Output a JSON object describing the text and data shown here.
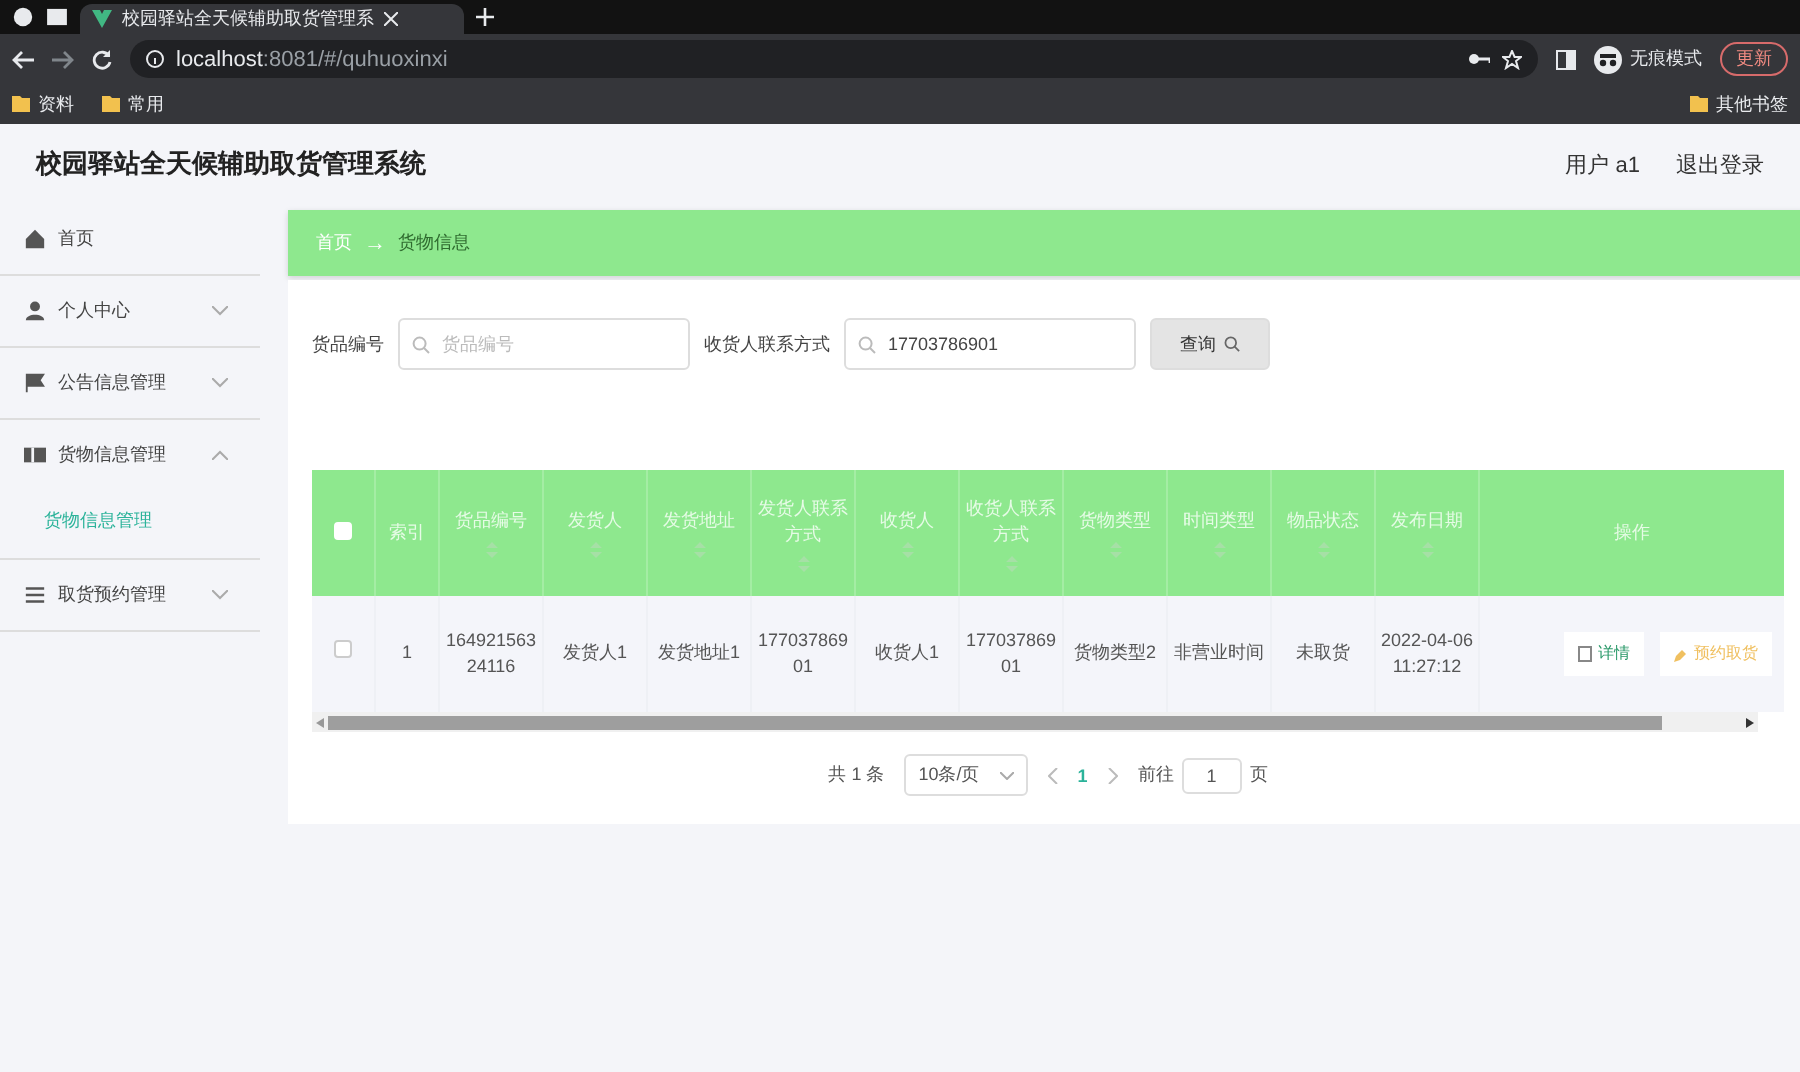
{
  "browser": {
    "tab_title": "校园驿站全天候辅助取货管理系",
    "address_host": "localhost",
    "address_rest": ":8081/#/quhuoxinxi",
    "profile_label": "无痕模式",
    "update_button": "更新",
    "bookmarks": [
      "资料",
      "常用"
    ],
    "other_bookmarks": "其他书签"
  },
  "header": {
    "title": "校园驿站全天候辅助取货管理系统",
    "user": "用户 a1",
    "logout": "退出登录"
  },
  "sidebar": {
    "items": [
      {
        "label": "首页",
        "kind": "link"
      },
      {
        "label": "个人中心",
        "kind": "menu",
        "expanded": false
      },
      {
        "label": "公告信息管理",
        "kind": "menu",
        "expanded": false
      },
      {
        "label": "货物信息管理",
        "kind": "menu",
        "expanded": true,
        "children": [
          {
            "label": "货物信息管理",
            "selected": true
          }
        ]
      },
      {
        "label": "取货预约管理",
        "kind": "menu",
        "expanded": false
      }
    ]
  },
  "breadcrumb": {
    "items": [
      "首页",
      "货物信息"
    ],
    "separator": "→"
  },
  "search": {
    "fields": [
      {
        "label": "货品编号",
        "placeholder": "货品编号"
      },
      {
        "label": "收货人联系方式",
        "value": "17703786901"
      }
    ],
    "button": "查询"
  },
  "table": {
    "select_all_checked": false,
    "columns": [
      {
        "label": "索引",
        "sortable": false
      },
      {
        "label": "货品编号",
        "sortable": true
      },
      {
        "label": "发货人",
        "sortable": true
      },
      {
        "label": "发货地址",
        "sortable": true
      },
      {
        "label": "发货人联系方式",
        "sortable": true
      },
      {
        "label": "收货人",
        "sortable": true
      },
      {
        "label": "收货人联系方式",
        "sortable": true
      },
      {
        "label": "货物类型",
        "sortable": true
      },
      {
        "label": "时间类型",
        "sortable": true
      },
      {
        "label": "物品状态",
        "sortable": true
      },
      {
        "label": "发布日期",
        "sortable": true
      },
      {
        "label": "操作",
        "sortable": false
      }
    ],
    "rows": [
      {
        "checked": false,
        "cells": [
          "1",
          "16492156324116",
          "发货人1",
          "发货地址1",
          "17703786901",
          "收货人1",
          "17703786901",
          "货物类型2",
          "非营业时间",
          "未取货",
          "2022-04-06 11:27:12"
        ],
        "actions": [
          {
            "label": "详情",
            "kind": "view"
          },
          {
            "label": "预约取货",
            "kind": "book"
          }
        ]
      }
    ]
  },
  "pager": {
    "total": "共 1 条",
    "page_size": "10条/页",
    "pages": [
      {
        "label": "1",
        "selected": true
      }
    ],
    "goto_label": "前往",
    "goto_value": "1",
    "goto_suffix": "页"
  }
}
